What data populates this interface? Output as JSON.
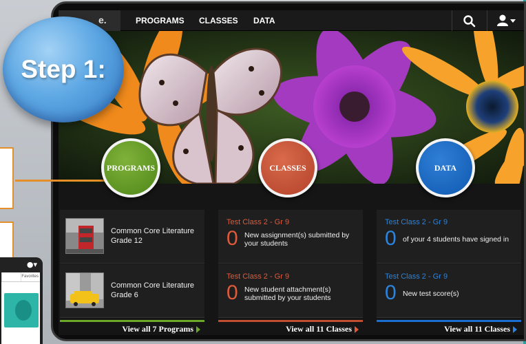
{
  "step_bubble": {
    "text": "Step 1:"
  },
  "navbar": {
    "logo_partial": "e.",
    "links": [
      "PROGRAMS",
      "CLASSES",
      "DATA"
    ],
    "icons": [
      "search-icon",
      "user-icon"
    ]
  },
  "sections": [
    {
      "label": "PROGRAMS",
      "color": "#5e9a22"
    },
    {
      "label": "CLASSES",
      "color": "#c04a2e"
    },
    {
      "label": "DATA",
      "color": "#1462c0"
    }
  ],
  "programs": {
    "items": [
      {
        "title": "Common Core Literature Grade 12"
      },
      {
        "title": "Common Core Literature Grade 6"
      }
    ],
    "view_all": "View all 7 Programs"
  },
  "classes": {
    "items": [
      {
        "class": "Test Class 2 - Gr 9",
        "count": "0",
        "text": "New assignment(s) submitted by your students"
      },
      {
        "class": "Test Class 2 - Gr 9",
        "count": "0",
        "text": "New student attachment(s) submitted by your students"
      }
    ],
    "view_all": "View all 11 Classes"
  },
  "data_panel": {
    "items": [
      {
        "class": "Test Class 2 - Gr 9",
        "count": "0",
        "text": "of your 4 students have signed in"
      },
      {
        "class": "Test Class 2 - Gr 9",
        "count": "0",
        "text": "New test score(s)"
      }
    ],
    "view_all": "View all 11 Classes"
  },
  "phone": {
    "tab_label": "Favorites"
  }
}
